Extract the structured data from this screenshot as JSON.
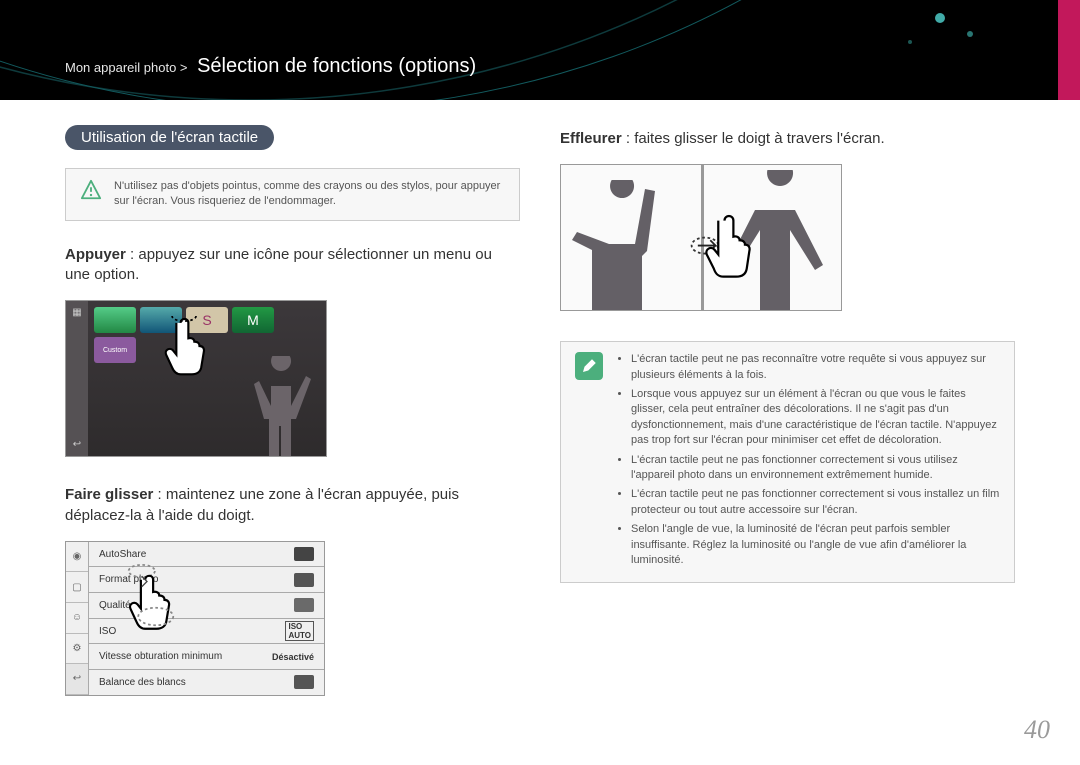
{
  "header": {
    "breadcrumb_prefix": "Mon appareil photo >",
    "title": "Sélection de fonctions (options)"
  },
  "left": {
    "pill": "Utilisation de l'écran tactile",
    "warning": "N'utilisez pas d'objets pointus, comme des crayons ou des stylos, pour appuyer sur l'écran. Vous risqueriez de l'endommager.",
    "appuyer_label": "Appuyer",
    "appuyer_text": " : appuyez sur une icône pour sélectionner un menu ou une option.",
    "glisser_label": "Faire glisser",
    "glisser_text": " : maintenez une zone à l'écran appuyée, puis déplacez-la à l'aide du doigt.",
    "settings_rows": [
      {
        "label": "AutoShare",
        "value_icon": "toggle"
      },
      {
        "label": "Format photo",
        "value_icon": "size-20m"
      },
      {
        "label": "Qualité",
        "value_icon": "quality"
      },
      {
        "label": "ISO",
        "value_icon": "iso-auto"
      },
      {
        "label": "Vitesse obturation minimum",
        "value": "Désactivé"
      },
      {
        "label": "Balance des blancs",
        "value_icon": "awb"
      }
    ]
  },
  "right": {
    "effleurer_label": "Effleurer",
    "effleurer_text": " : faites glisser le doigt à travers l'écran.",
    "notes": [
      "L'écran tactile peut ne pas reconnaître votre requête si vous appuyez sur plusieurs éléments à la fois.",
      "Lorsque vous appuyez sur un élément à l'écran ou que vous le faites glisser, cela peut entraîner des décolorations. Il ne s'agit pas d'un dysfonctionnement, mais d'une caractéristique de l'écran tactile. N'appuyez pas trop fort sur l'écran pour minimiser cet effet de décoloration.",
      "L'écran tactile peut ne pas fonctionner correctement si vous utilisez l'appareil photo dans un environnement extrêmement humide.",
      "L'écran tactile peut ne pas fonctionner correctement si vous installez un film protecteur ou tout autre accessoire sur l'écran.",
      "Selon l'angle de vue, la luminosité de l'écran peut parfois sembler insuffisante. Réglez la luminosité ou l'angle de vue afin d'améliorer la luminosité."
    ]
  },
  "page_number": "40"
}
